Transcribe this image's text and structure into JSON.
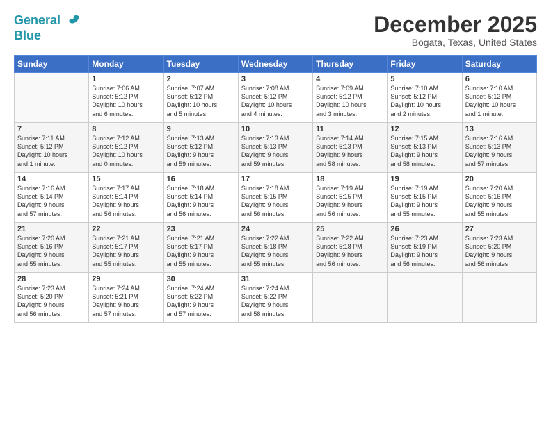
{
  "header": {
    "logo_line1": "General",
    "logo_line2": "Blue",
    "month": "December 2025",
    "location": "Bogata, Texas, United States"
  },
  "weekdays": [
    "Sunday",
    "Monday",
    "Tuesday",
    "Wednesday",
    "Thursday",
    "Friday",
    "Saturday"
  ],
  "weeks": [
    [
      {
        "day": "",
        "info": ""
      },
      {
        "day": "1",
        "info": "Sunrise: 7:06 AM\nSunset: 5:12 PM\nDaylight: 10 hours\nand 6 minutes."
      },
      {
        "day": "2",
        "info": "Sunrise: 7:07 AM\nSunset: 5:12 PM\nDaylight: 10 hours\nand 5 minutes."
      },
      {
        "day": "3",
        "info": "Sunrise: 7:08 AM\nSunset: 5:12 PM\nDaylight: 10 hours\nand 4 minutes."
      },
      {
        "day": "4",
        "info": "Sunrise: 7:09 AM\nSunset: 5:12 PM\nDaylight: 10 hours\nand 3 minutes."
      },
      {
        "day": "5",
        "info": "Sunrise: 7:10 AM\nSunset: 5:12 PM\nDaylight: 10 hours\nand 2 minutes."
      },
      {
        "day": "6",
        "info": "Sunrise: 7:10 AM\nSunset: 5:12 PM\nDaylight: 10 hours\nand 1 minute."
      }
    ],
    [
      {
        "day": "7",
        "info": "Sunrise: 7:11 AM\nSunset: 5:12 PM\nDaylight: 10 hours\nand 1 minute."
      },
      {
        "day": "8",
        "info": "Sunrise: 7:12 AM\nSunset: 5:12 PM\nDaylight: 10 hours\nand 0 minutes."
      },
      {
        "day": "9",
        "info": "Sunrise: 7:13 AM\nSunset: 5:12 PM\nDaylight: 9 hours\nand 59 minutes."
      },
      {
        "day": "10",
        "info": "Sunrise: 7:13 AM\nSunset: 5:13 PM\nDaylight: 9 hours\nand 59 minutes."
      },
      {
        "day": "11",
        "info": "Sunrise: 7:14 AM\nSunset: 5:13 PM\nDaylight: 9 hours\nand 58 minutes."
      },
      {
        "day": "12",
        "info": "Sunrise: 7:15 AM\nSunset: 5:13 PM\nDaylight: 9 hours\nand 58 minutes."
      },
      {
        "day": "13",
        "info": "Sunrise: 7:16 AM\nSunset: 5:13 PM\nDaylight: 9 hours\nand 57 minutes."
      }
    ],
    [
      {
        "day": "14",
        "info": "Sunrise: 7:16 AM\nSunset: 5:14 PM\nDaylight: 9 hours\nand 57 minutes."
      },
      {
        "day": "15",
        "info": "Sunrise: 7:17 AM\nSunset: 5:14 PM\nDaylight: 9 hours\nand 56 minutes."
      },
      {
        "day": "16",
        "info": "Sunrise: 7:18 AM\nSunset: 5:14 PM\nDaylight: 9 hours\nand 56 minutes."
      },
      {
        "day": "17",
        "info": "Sunrise: 7:18 AM\nSunset: 5:15 PM\nDaylight: 9 hours\nand 56 minutes."
      },
      {
        "day": "18",
        "info": "Sunrise: 7:19 AM\nSunset: 5:15 PM\nDaylight: 9 hours\nand 56 minutes."
      },
      {
        "day": "19",
        "info": "Sunrise: 7:19 AM\nSunset: 5:15 PM\nDaylight: 9 hours\nand 55 minutes."
      },
      {
        "day": "20",
        "info": "Sunrise: 7:20 AM\nSunset: 5:16 PM\nDaylight: 9 hours\nand 55 minutes."
      }
    ],
    [
      {
        "day": "21",
        "info": "Sunrise: 7:20 AM\nSunset: 5:16 PM\nDaylight: 9 hours\nand 55 minutes."
      },
      {
        "day": "22",
        "info": "Sunrise: 7:21 AM\nSunset: 5:17 PM\nDaylight: 9 hours\nand 55 minutes."
      },
      {
        "day": "23",
        "info": "Sunrise: 7:21 AM\nSunset: 5:17 PM\nDaylight: 9 hours\nand 55 minutes."
      },
      {
        "day": "24",
        "info": "Sunrise: 7:22 AM\nSunset: 5:18 PM\nDaylight: 9 hours\nand 55 minutes."
      },
      {
        "day": "25",
        "info": "Sunrise: 7:22 AM\nSunset: 5:18 PM\nDaylight: 9 hours\nand 56 minutes."
      },
      {
        "day": "26",
        "info": "Sunrise: 7:23 AM\nSunset: 5:19 PM\nDaylight: 9 hours\nand 56 minutes."
      },
      {
        "day": "27",
        "info": "Sunrise: 7:23 AM\nSunset: 5:20 PM\nDaylight: 9 hours\nand 56 minutes."
      }
    ],
    [
      {
        "day": "28",
        "info": "Sunrise: 7:23 AM\nSunset: 5:20 PM\nDaylight: 9 hours\nand 56 minutes."
      },
      {
        "day": "29",
        "info": "Sunrise: 7:24 AM\nSunset: 5:21 PM\nDaylight: 9 hours\nand 57 minutes."
      },
      {
        "day": "30",
        "info": "Sunrise: 7:24 AM\nSunset: 5:22 PM\nDaylight: 9 hours\nand 57 minutes."
      },
      {
        "day": "31",
        "info": "Sunrise: 7:24 AM\nSunset: 5:22 PM\nDaylight: 9 hours\nand 58 minutes."
      },
      {
        "day": "",
        "info": ""
      },
      {
        "day": "",
        "info": ""
      },
      {
        "day": "",
        "info": ""
      }
    ]
  ]
}
